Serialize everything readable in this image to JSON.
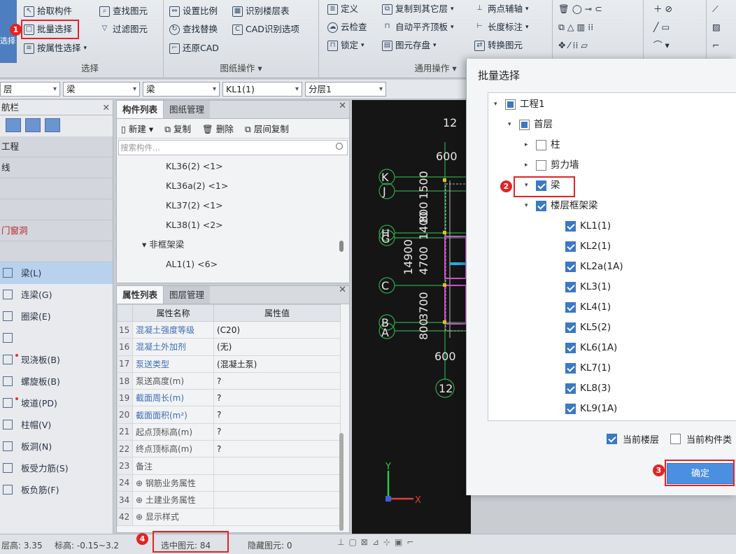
{
  "ribbon": {
    "select_group": {
      "label": "选择",
      "pick": "拾取构件",
      "batch_select": "批量选择",
      "select_by_attr": "按属性选择",
      "find_element": "查找图元",
      "filter_element": "过滤图元",
      "vertical_label": "选择"
    },
    "drawing_group": {
      "label": "图纸操作",
      "set_scale": "设置比例",
      "identify_floor_table": "识别楼层表",
      "find_replace": "查找替换",
      "cad_options": "CAD识别选项",
      "restore_cad": "还原CAD"
    },
    "common_group": {
      "label": "通用操作",
      "define": "定义",
      "copy_to_other_layer": "复制到其它层",
      "two_point_axis": "两点辅轴",
      "cloud_check": "云检查",
      "auto_flat_top": "自动平齐顶板",
      "length_dim": "长度标注",
      "lock": "锁定",
      "element_store": "图元存盘",
      "convert_element": "转换图元"
    }
  },
  "combos": [
    "层",
    "梁",
    "梁",
    "KL1(1)",
    "分层1"
  ],
  "nav": {
    "title": "航栏",
    "categories": [
      {
        "label": "工程",
        "red": false
      },
      {
        "label": "线",
        "red": false
      },
      {
        "label": "",
        "red": false
      },
      {
        "label": "",
        "red": false
      },
      {
        "label": "门窗洞",
        "red": true
      },
      {
        "label": "",
        "red": false
      }
    ],
    "items": [
      {
        "label": "梁(L)",
        "selected": true,
        "dot": false
      },
      {
        "label": "连梁(G)",
        "selected": false,
        "dot": false
      },
      {
        "label": "圈梁(E)",
        "selected": false,
        "dot": false
      },
      {
        "label": "",
        "selected": false,
        "dot": false
      },
      {
        "label": "现浇板(B)",
        "selected": false,
        "dot": true
      },
      {
        "label": "螺旋板(B)",
        "selected": false,
        "dot": false
      },
      {
        "label": "坡道(PD)",
        "selected": false,
        "dot": true
      },
      {
        "label": "柱帽(V)",
        "selected": false,
        "dot": false
      },
      {
        "label": "板洞(N)",
        "selected": false,
        "dot": false
      },
      {
        "label": "板受力筋(S)",
        "selected": false,
        "dot": false
      },
      {
        "label": "板负筋(F)",
        "selected": false,
        "dot": false
      }
    ]
  },
  "component_list": {
    "tab_active": "构件列表",
    "tab_inactive": "图纸管理",
    "toolbar": {
      "new": "新建",
      "copy": "复制",
      "delete": "删除",
      "floor_copy": "层间复制"
    },
    "search_placeholder": "搜索构件...",
    "rows": [
      {
        "label": "KL36(2) <1>",
        "group": false
      },
      {
        "label": "KL36a(2) <1>",
        "group": false
      },
      {
        "label": "KL37(2) <1>",
        "group": false
      },
      {
        "label": "KL38(1) <2>",
        "group": false
      },
      {
        "label": "▾ 非框架梁",
        "group": true
      },
      {
        "label": "AL1(1) <6>",
        "group": false
      }
    ]
  },
  "properties": {
    "tab_active": "属性列表",
    "tab_inactive": "图层管理",
    "col_name": "属性名称",
    "col_value": "属性值",
    "rows": [
      {
        "num": "15",
        "name": "混凝土强度等级",
        "value": "(C20)",
        "link": true
      },
      {
        "num": "16",
        "name": "混凝土外加剂",
        "value": "(无)",
        "link": true
      },
      {
        "num": "17",
        "name": "泵送类型",
        "value": "(混凝土泵)",
        "link": true
      },
      {
        "num": "18",
        "name": "泵送高度(m)",
        "value": "?",
        "link": false
      },
      {
        "num": "19",
        "name": "截面周长(m)",
        "value": "?",
        "link": true
      },
      {
        "num": "20",
        "name": "截面面积(m²)",
        "value": "?",
        "link": true
      },
      {
        "num": "21",
        "name": "起点顶标高(m)",
        "value": "?",
        "link": false
      },
      {
        "num": "22",
        "name": "终点顶标高(m)",
        "value": "?",
        "link": false
      },
      {
        "num": "23",
        "name": "备注",
        "value": "",
        "link": false
      },
      {
        "num": "24",
        "name": "⊕ 钢筋业务属性",
        "value": "",
        "link": false
      },
      {
        "num": "34",
        "name": "⊕ 土建业务属性",
        "value": "",
        "link": false
      },
      {
        "num": "42",
        "name": "⊕ 显示样式",
        "value": "",
        "link": false
      }
    ]
  },
  "status": {
    "floor_height": "层高: 3.35",
    "elevation": "标高: -0.15~3.2",
    "selected_count": "选中图元: 84",
    "hidden_count": "隐藏图元: 0"
  },
  "cad": {
    "top_num": "12",
    "dim1": "600",
    "dim_vertical": "14900",
    "dim_v2": "4700",
    "dim_v3": "3700",
    "dim_v4": "800",
    "dim_v5": "1500",
    "dim_v6": "800",
    "dim_v7": "1400",
    "bottom_dim": "600",
    "bottom_num": "12",
    "axes": [
      "K",
      "J",
      "H",
      "G",
      "C",
      "B",
      "A"
    ],
    "axis_y": "Y",
    "axis_x": "X"
  },
  "dialog": {
    "title": "批量选择",
    "tree": [
      {
        "label": "工程1",
        "level": 0,
        "state": "partial",
        "arrow": "▾"
      },
      {
        "label": "首层",
        "level": 1,
        "state": "partial",
        "arrow": "▾"
      },
      {
        "label": "柱",
        "level": 2,
        "state": "empty",
        "arrow": "▸"
      },
      {
        "label": "剪力墙",
        "level": 2,
        "state": "empty",
        "arrow": "▸"
      },
      {
        "label": "梁",
        "level": 2,
        "state": "checked",
        "arrow": "▾"
      },
      {
        "label": "楼层框架梁",
        "level": 3,
        "state": "checked",
        "arrow": "▾"
      },
      {
        "label": "KL1(1)",
        "level": 4,
        "state": "checked",
        "arrow": ""
      },
      {
        "label": "KL2(1)",
        "level": 4,
        "state": "checked",
        "arrow": ""
      },
      {
        "label": "KL2a(1A)",
        "level": 4,
        "state": "checked",
        "arrow": ""
      },
      {
        "label": "KL3(1)",
        "level": 4,
        "state": "checked",
        "arrow": ""
      },
      {
        "label": "KL4(1)",
        "level": 4,
        "state": "checked",
        "arrow": ""
      },
      {
        "label": "KL5(2)",
        "level": 4,
        "state": "checked",
        "arrow": ""
      },
      {
        "label": "KL6(1A)",
        "level": 4,
        "state": "checked",
        "arrow": ""
      },
      {
        "label": "KL7(1)",
        "level": 4,
        "state": "checked",
        "arrow": ""
      },
      {
        "label": "KL8(3)",
        "level": 4,
        "state": "checked",
        "arrow": ""
      },
      {
        "label": "KL9(1A)",
        "level": 4,
        "state": "checked",
        "arrow": ""
      }
    ],
    "current_floor": "当前楼层",
    "current_component_type": "当前构件类",
    "ok": "确定"
  },
  "annotations": [
    "1",
    "2",
    "3",
    "4"
  ],
  "colors": {
    "accent": "#3a78c8",
    "highlight": "#e02424",
    "ok_button": "#4b8fe0"
  }
}
